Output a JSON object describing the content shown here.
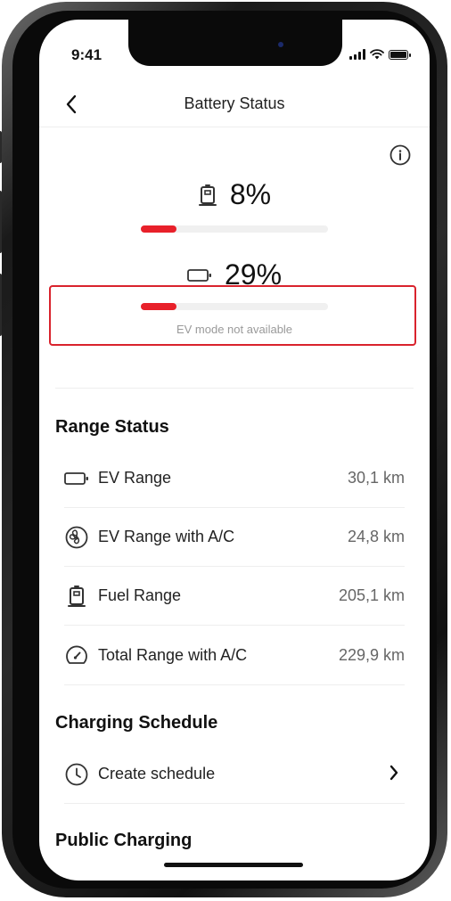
{
  "status_bar": {
    "time": "9:41"
  },
  "header": {
    "title": "Battery Status"
  },
  "fuel_gauge": {
    "value": "8%",
    "level": 0.19,
    "icon": "fuel-pump-icon"
  },
  "ev_gauge": {
    "value": "29%",
    "level": 0.19,
    "icon": "battery-icon",
    "note": "EV mode not available"
  },
  "range_status": {
    "title": "Range Status",
    "items": [
      {
        "label": "EV Range",
        "value": "30,1 km",
        "icon": "battery-icon"
      },
      {
        "label": "EV Range with A/C",
        "value": "24,8 km",
        "icon": "fan-icon"
      },
      {
        "label": "Fuel Range",
        "value": "205,1 km",
        "icon": "fuel-pump-icon"
      },
      {
        "label": "Total Range with A/C",
        "value": "229,9 km",
        "icon": "gauge-icon"
      }
    ]
  },
  "charging_schedule": {
    "title": "Charging Schedule",
    "create_label": "Create schedule"
  },
  "public_charging": {
    "title": "Public Charging"
  },
  "colors": {
    "accent": "#e8202a",
    "highlight_border": "#d9232d"
  }
}
